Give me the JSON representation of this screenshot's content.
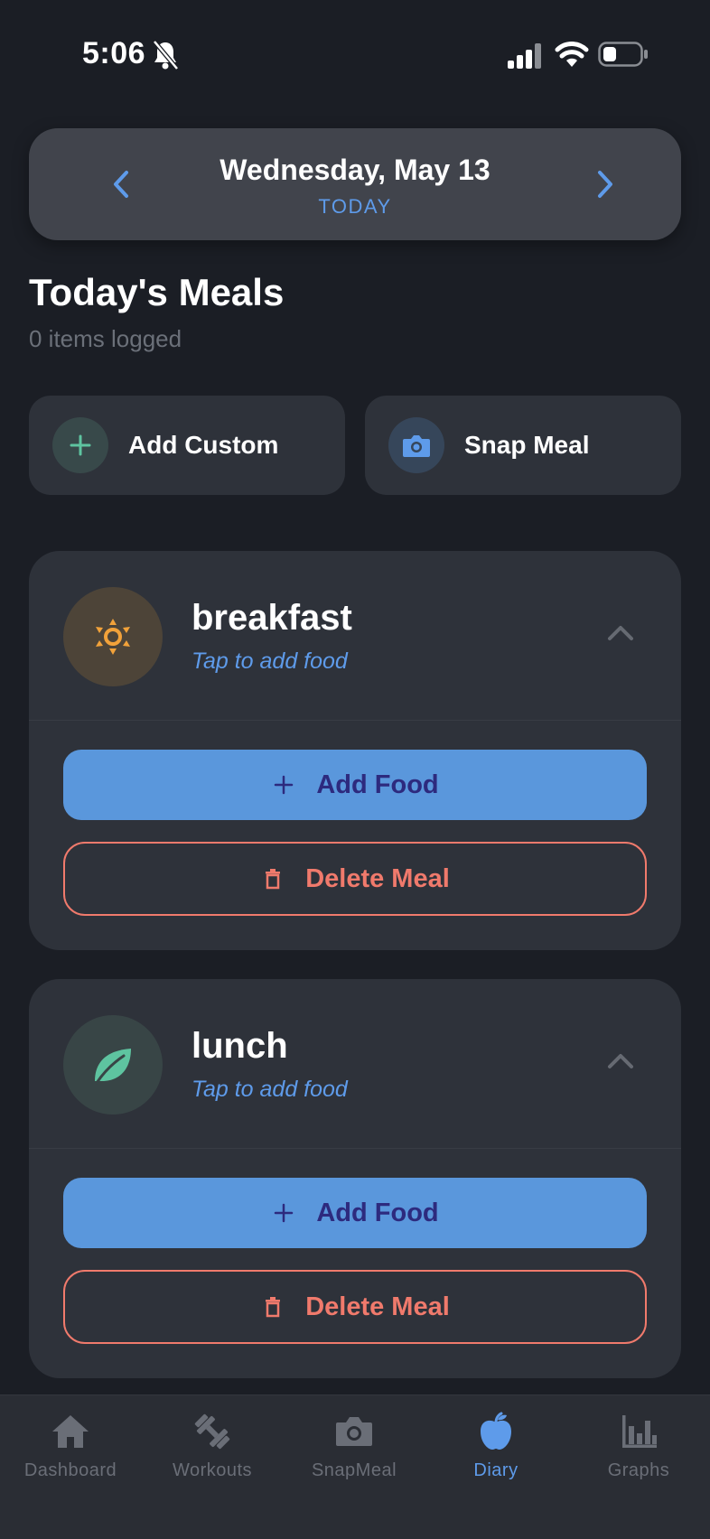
{
  "status_bar": {
    "time": "5:06"
  },
  "date_nav": {
    "title": "Wednesday, May 13",
    "subtitle": "TODAY"
  },
  "header": {
    "title": "Today's Meals",
    "subtitle": "0 items logged"
  },
  "quick_actions": {
    "add_custom": {
      "label": "Add Custom",
      "icon": "plus-icon"
    },
    "snap_meal": {
      "label": "Snap Meal",
      "icon": "camera-icon"
    }
  },
  "meals": [
    {
      "name": "breakfast",
      "hint": "Tap to add food",
      "icon": "sun-icon",
      "add_label": "Add Food",
      "delete_label": "Delete Meal"
    },
    {
      "name": "lunch",
      "hint": "Tap to add food",
      "icon": "leaf-icon",
      "add_label": "Add Food",
      "delete_label": "Delete Meal"
    }
  ],
  "tabs": [
    {
      "label": "Dashboard",
      "icon": "home-icon",
      "active": false
    },
    {
      "label": "Workouts",
      "icon": "dumbbell-icon",
      "active": false
    },
    {
      "label": "SnapMeal",
      "icon": "camera-icon",
      "active": false
    },
    {
      "label": "Diary",
      "icon": "apple-icon",
      "active": true
    },
    {
      "label": "Graphs",
      "icon": "bar-chart-icon",
      "active": false
    }
  ],
  "colors": {
    "background": "#1b1e25",
    "card": "#2e323a",
    "accent_blue": "#5a97dc",
    "delete_red": "#f07a6c",
    "muted_text": "#6a6e77"
  }
}
